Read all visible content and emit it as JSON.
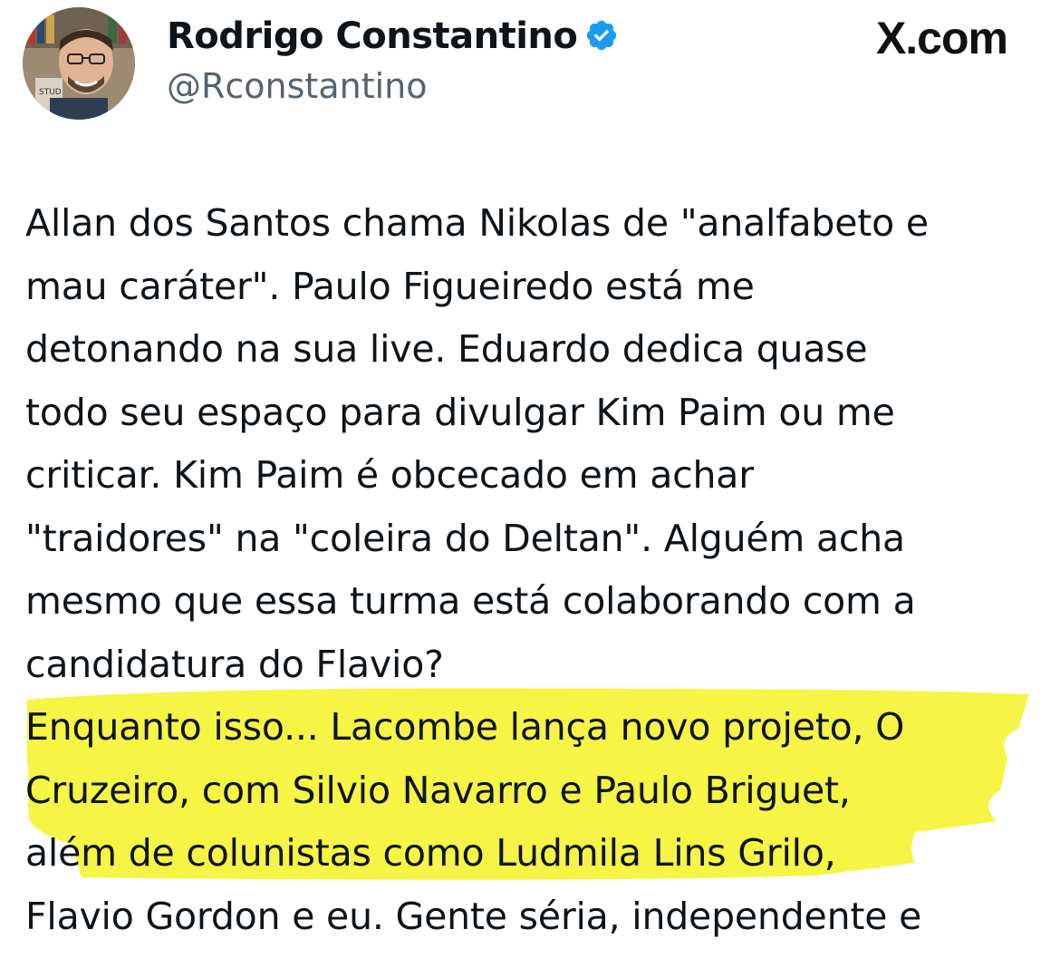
{
  "author": {
    "display_name": "Rodrigo Constantino",
    "handle": "@Rconstantino",
    "verified": true
  },
  "source_watermark": "X.com",
  "tweet": {
    "lines": [
      "Allan dos Santos chama Nikolas de \"analfabeto e",
      "mau caráter\". Paulo Figueiredo está me",
      "detonando na sua live. Eduardo dedica quase",
      "todo seu espaço para divulgar Kim Paim ou me",
      "criticar. Kim Paim é obcecado em achar",
      "\"traidores\" na \"coleira do Deltan\". Alguém acha",
      "mesmo que essa turma está colaborando com a",
      "candidatura do Flavio?",
      "Enquanto isso... Lacombe lança novo projeto, O",
      "Cruzeiro, com Silvio Navarro e Paulo Briguet,",
      "além de colunistas como Ludmila Lins Grilo,",
      "Flavio Gordon e eu. Gente séria, independente e"
    ],
    "highlighted_lines": [
      8,
      9,
      10
    ]
  },
  "colors": {
    "verified_badge": "#1d9bf0",
    "handle_text": "#536471",
    "body_text": "#0f1419",
    "highlighter": "#f5f32a"
  }
}
